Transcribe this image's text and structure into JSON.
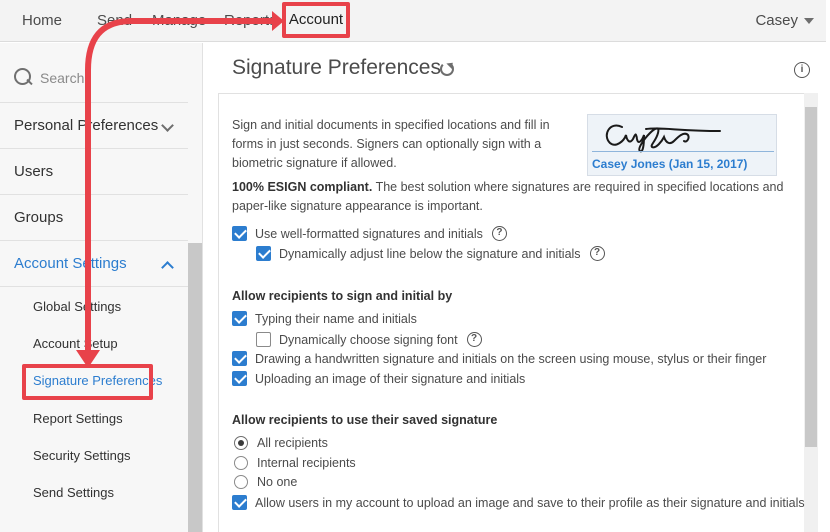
{
  "topnav": {
    "home": "Home",
    "send": "Send",
    "manage": "Manage",
    "reports": "Reports",
    "account": "Account",
    "user": "Casey"
  },
  "sidebar": {
    "search_placeholder": "Search",
    "items": [
      {
        "label": "Personal Preferences"
      },
      {
        "label": "Users"
      },
      {
        "label": "Groups"
      },
      {
        "label": "Account Settings"
      }
    ],
    "sub_items": [
      {
        "label": "Global Settings"
      },
      {
        "label": "Account Setup"
      },
      {
        "label": "Signature Preferences"
      },
      {
        "label": "Report Settings"
      },
      {
        "label": "Security Settings"
      },
      {
        "label": "Send Settings"
      }
    ]
  },
  "main": {
    "title": "Signature Preferences",
    "intro": "Sign and initial documents in specified locations and fill in forms in just seconds. Signers can optionally sign with a biometric signature if allowed.",
    "signature_caption": "Casey Jones (Jan 15, 2017)",
    "esign_bold": "100% ESIGN compliant.",
    "esign_text": " The best solution where signatures are required in specified locations and paper-like signature appearance is important.",
    "opt_wellformatted": "Use well-formatted signatures and initials",
    "opt_adjustline": "Dynamically adjust line below the signature and initials",
    "section_sign": "Allow recipients to sign and initial by",
    "opt_typing": "Typing their name and initials",
    "opt_choosefont": "Dynamically choose signing font",
    "opt_drawing": "Drawing a handwritten signature and initials on the screen using mouse, stylus or their finger",
    "opt_uploading": "Uploading an image of their signature and initials",
    "section_saved": "Allow recipients to use their saved signature",
    "radio_all": "All recipients",
    "radio_internal": "Internal recipients",
    "radio_none": "No one",
    "opt_allowupload": "Allow users in my account to upload an image and save to their profile as their signature and initials"
  },
  "colors": {
    "accent": "#2c7dcf",
    "annotation": "#e8424a"
  }
}
